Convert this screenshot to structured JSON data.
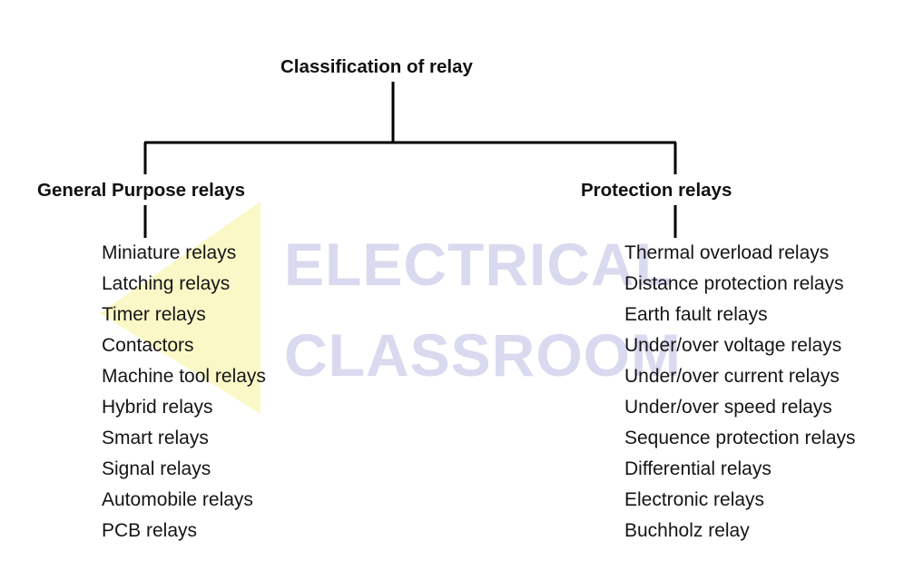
{
  "diagram": {
    "title": "Classification of relay",
    "branches": [
      {
        "label": "General Purpose relays",
        "items": [
          "Miniature relays",
          "Latching relays",
          "Timer relays",
          "Contactors",
          "Machine tool relays",
          "Hybrid relays",
          "Smart relays",
          "Signal relays",
          "Automobile relays",
          "PCB relays"
        ]
      },
      {
        "label": "Protection relays",
        "items": [
          "Thermal overload relays",
          "Distance protection relays",
          "Earth fault relays",
          "Under/over voltage relays",
          "Under/over current relays",
          "Under/over speed relays",
          "Sequence protection relays",
          "Differential relays",
          "Electronic relays",
          "Buchholz relay"
        ]
      }
    ]
  },
  "watermark": {
    "line1": "ELECTRICAL",
    "line2": "CLASSROOM",
    "text_color": "#d9d9ef",
    "triangle_color": "#fbf8c4"
  },
  "colors": {
    "line": "#000000",
    "text": "#111111",
    "background": "#ffffff"
  }
}
